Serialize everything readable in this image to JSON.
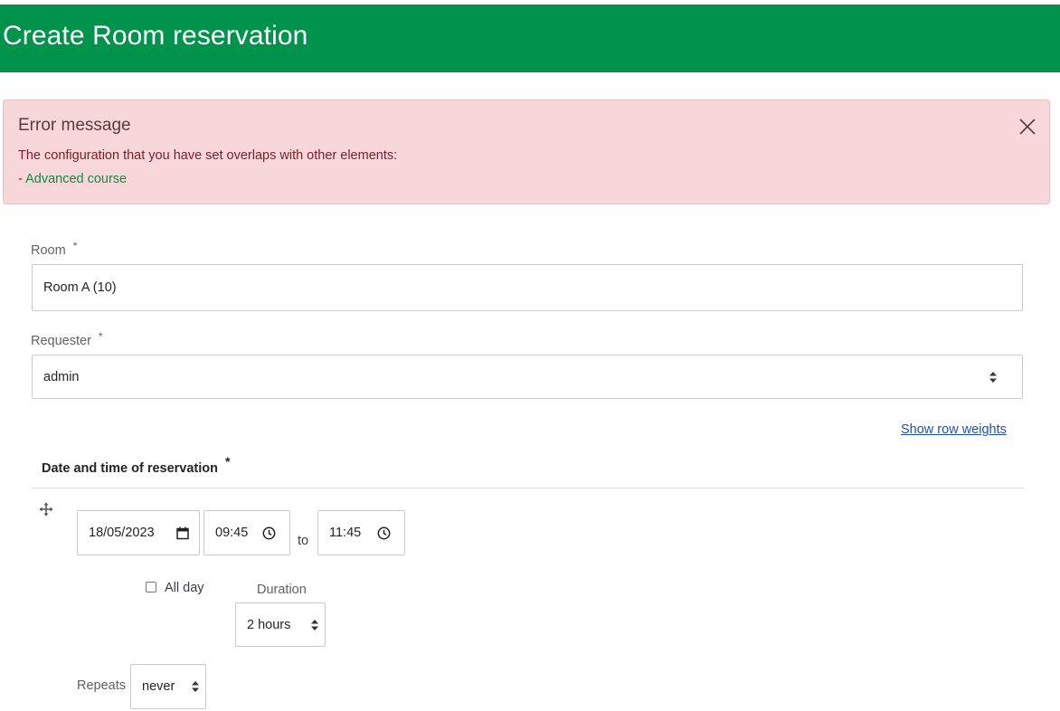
{
  "header": {
    "title": "Create Room reservation"
  },
  "alert": {
    "title": "Error message",
    "text": "The configuration that you have set overlaps with other elements:",
    "prefix": "-",
    "link": "Advanced course"
  },
  "form": {
    "room": {
      "label": "Room",
      "required": "*",
      "value": "Room A (10)"
    },
    "requester": {
      "label": "Requester",
      "required": "*",
      "value": "admin"
    },
    "show_row_weights": "Show row weights",
    "datetime": {
      "title": "Date and time of reservation",
      "required": "*",
      "date": "18/05/2023",
      "start_time": "09:45",
      "to": "to",
      "end_time": "11:45",
      "all_day": {
        "label": "All day",
        "checked": false
      },
      "duration": {
        "label": "Duration",
        "value": "2 hours"
      },
      "repeats": {
        "label": "Repeats",
        "value": "never"
      }
    }
  },
  "colors": {
    "header": "#00934b",
    "alert_bg": "#f8d7da",
    "link": "#138a3e"
  }
}
